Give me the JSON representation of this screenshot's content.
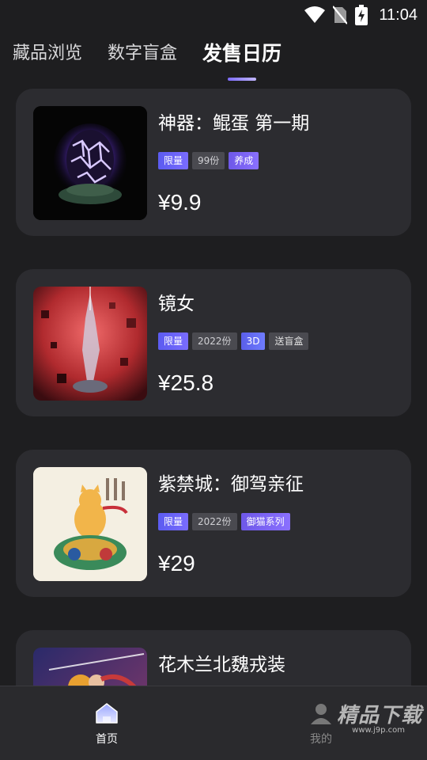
{
  "status_bar": {
    "time": "11:04",
    "icons": [
      "wifi-icon",
      "no-sim-icon",
      "battery-charging-icon"
    ]
  },
  "tabs": [
    {
      "label": "藏品浏览",
      "active": false
    },
    {
      "label": "数字盲盒",
      "active": false
    },
    {
      "label": "发售日历",
      "active": true
    }
  ],
  "items": [
    {
      "title": "神器：鲲蛋 第一期",
      "tags": [
        {
          "label": "限量",
          "kind": "limited"
        },
        {
          "label": "99份",
          "kind": "edition"
        },
        {
          "label": "养成",
          "kind": "series"
        }
      ],
      "price": "¥9.9"
    },
    {
      "title": "镜女",
      "tags": [
        {
          "label": "限量",
          "kind": "limited"
        },
        {
          "label": "2022份",
          "kind": "edition"
        },
        {
          "label": "3D",
          "kind": "feature"
        },
        {
          "label": "送盲盒",
          "kind": "plain"
        }
      ],
      "price": "¥25.8"
    },
    {
      "title": "紫禁城：御驾亲征",
      "tags": [
        {
          "label": "限量",
          "kind": "limited"
        },
        {
          "label": "2022份",
          "kind": "edition"
        },
        {
          "label": "御猫系列",
          "kind": "series"
        }
      ],
      "price": "¥29"
    },
    {
      "title": "花木兰北魏戎装",
      "tags": [],
      "price": ""
    }
  ],
  "bottom_nav": {
    "home_label": "首页",
    "mine_label": "我的"
  },
  "watermark": {
    "text": "精品下载",
    "sub": "www.j9p.com"
  }
}
